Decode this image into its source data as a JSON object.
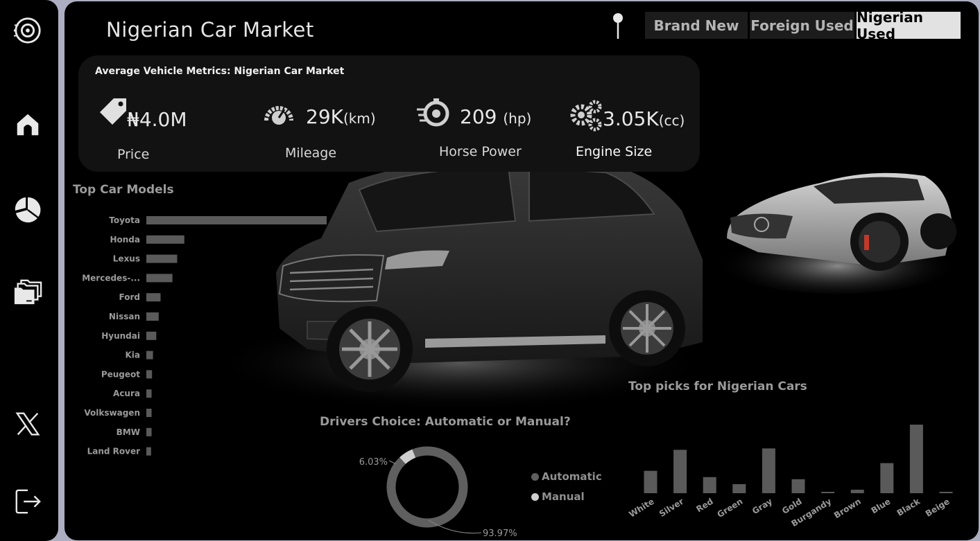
{
  "app": {
    "title": "Nigerian Car Market"
  },
  "sidebar": {
    "items": [
      {
        "name": "wheel-logo-icon"
      },
      {
        "name": "home-icon"
      },
      {
        "name": "pie-chart-icon"
      },
      {
        "name": "folders-icon"
      },
      {
        "name": "x-logo-icon"
      },
      {
        "name": "logout-icon"
      }
    ]
  },
  "tabs": [
    {
      "label": "Brand New",
      "active": false
    },
    {
      "label": "Foreign Used",
      "active": false
    },
    {
      "label": "Nigerian Used",
      "active": true
    }
  ],
  "metrics": {
    "title": "Average Vehicle Metrics: Nigerian Car Market",
    "price": {
      "value": "₦4.0M",
      "label": "Price",
      "icon": "price-tag-icon"
    },
    "mileage": {
      "value": "29K",
      "unit": "(km)",
      "label": "Mileage",
      "icon": "speedometer-icon"
    },
    "horsepower": {
      "value": "209",
      "unit": "(hp)",
      "label": "Horse Power",
      "icon": "fast-timer-icon"
    },
    "engine": {
      "value": "3.05K",
      "unit": "(cc)",
      "label": "Engine Size",
      "icon": "gears-icon"
    }
  },
  "colors": {
    "bar": "#5a5a5a",
    "accent_light": "#e2e2e2",
    "background": "#000000",
    "panel": "#121212"
  },
  "chart_data": [
    {
      "type": "bar",
      "orientation": "horizontal",
      "title": "Top Car Models",
      "categories": [
        "Toyota",
        "Honda",
        "Lexus",
        "Mercedes-...",
        "Ford",
        "Nissan",
        "Hyundai",
        "Kia",
        "Peugeot",
        "Acura",
        "Volkswagen",
        "BMW",
        "Land Rover"
      ],
      "values": [
        380,
        80,
        65,
        55,
        30,
        26,
        21,
        14,
        12,
        11,
        11,
        11,
        10
      ]
    },
    {
      "type": "pie",
      "donut": true,
      "title": "Drivers Choice: Automatic or Manual?",
      "slices": [
        {
          "name": "Automatic",
          "value": 93.97,
          "label": "93.97%",
          "color": "#5f5f5f"
        },
        {
          "name": "Manual",
          "value": 6.03,
          "label": "6.03%",
          "color": "#cfcfcf"
        }
      ]
    },
    {
      "type": "bar",
      "title": "Top picks for Nigerian Cars",
      "categories": [
        "White",
        "Silver",
        "Red",
        "Green",
        "Gray",
        "Gold",
        "Burgandy",
        "Brown",
        "Blue",
        "Black",
        "Beige"
      ],
      "values": [
        32,
        62,
        23,
        13,
        64,
        20,
        1,
        5,
        43,
        98,
        2
      ]
    }
  ]
}
